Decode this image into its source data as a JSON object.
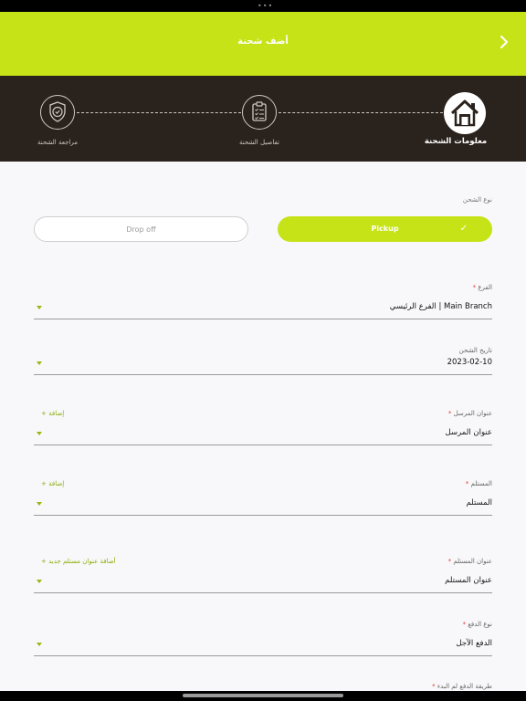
{
  "header": {
    "title": "أضف شحنة"
  },
  "stepper": {
    "steps": [
      {
        "label": "معلومات الشحنة",
        "icon": "house-icon",
        "active": true
      },
      {
        "label": "تفاصيل الشحنة",
        "icon": "clipboard-checklist-icon",
        "active": false
      },
      {
        "label": "مراجعة الشحنة",
        "icon": "shield-check-icon",
        "active": false
      }
    ]
  },
  "shipping_type": {
    "label": "نوع الشحن",
    "options": [
      "Pickup",
      "Drop off"
    ],
    "selected": "Pickup"
  },
  "form": {
    "branch": {
      "label": "الفرع",
      "required": "*",
      "value": "الفرع الرئيسي | Main Branch"
    },
    "date": {
      "label": "تاريخ الشحن",
      "value": "2023-02-10"
    },
    "sender_address": {
      "label": "عنوان المرسل",
      "required": "*",
      "value": "عنوان المرسل",
      "add": "+ إضافة"
    },
    "receiver": {
      "label": "المستلم",
      "required": "*",
      "value": "المستلم",
      "add": "+ إضافة"
    },
    "receiver_address": {
      "label": "عنوان المستلم",
      "required": "*",
      "value": "عنوان المستلم",
      "add": "+ أضافة عنوان مستلم جديد"
    },
    "payment_type": {
      "label": "نوع الدفع",
      "required": "*",
      "value": "الدفع الآجل"
    },
    "payment_method": {
      "label": "طريقة الدفع لم البدء",
      "required": "*"
    }
  },
  "colors": {
    "accent": "#c6e318",
    "dark": "#2a221d",
    "required": "#e53935"
  }
}
